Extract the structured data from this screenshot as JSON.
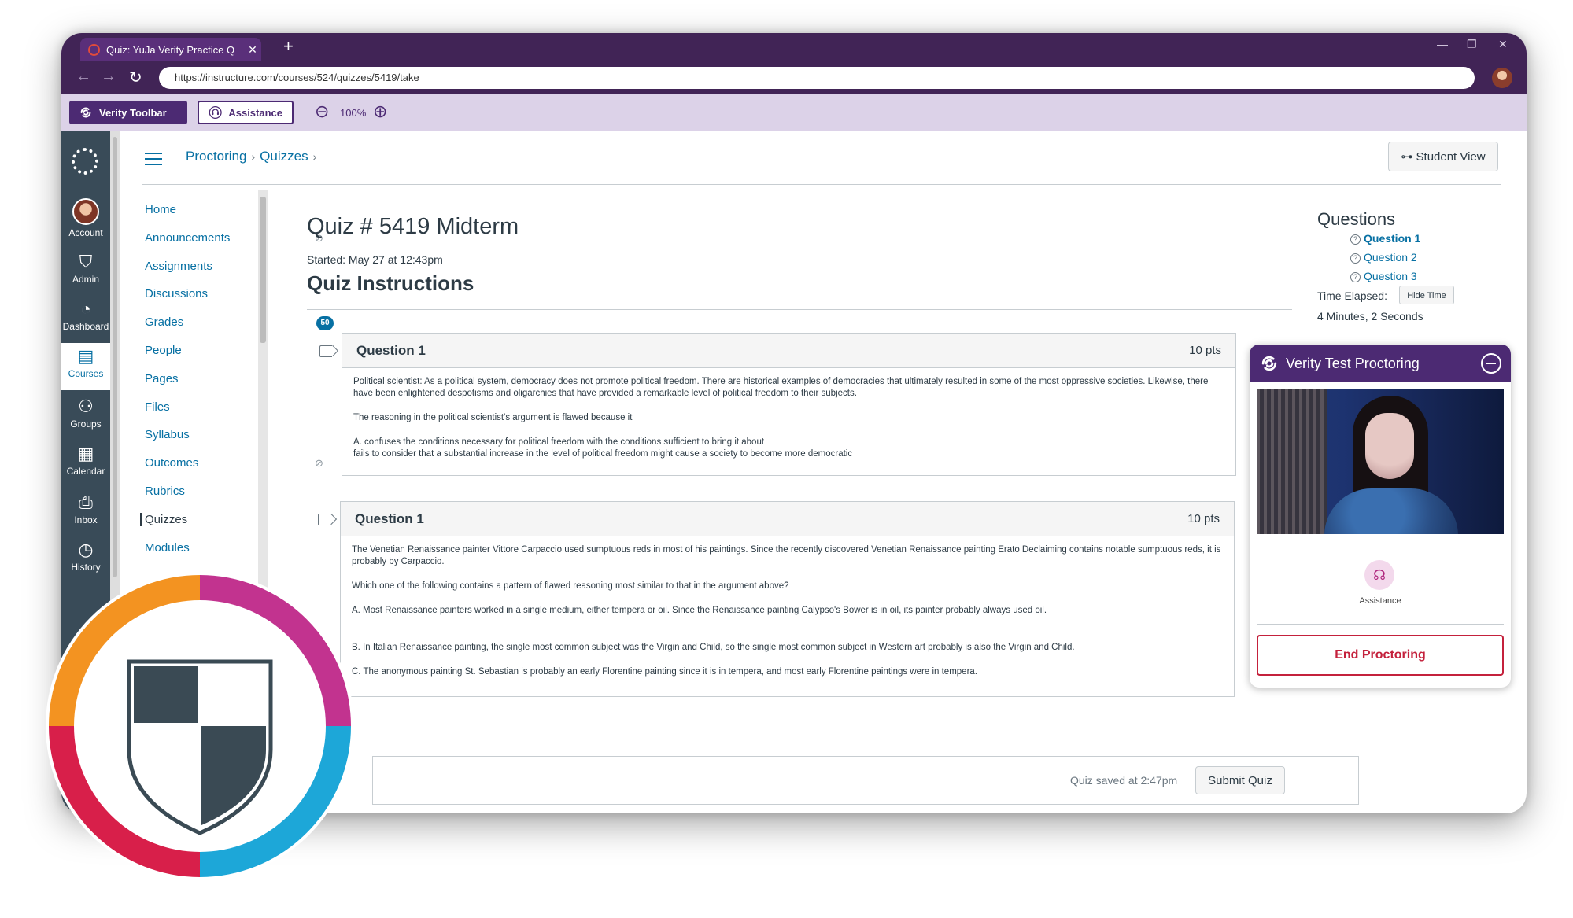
{
  "browser": {
    "tab_title": "Quiz: YuJa Verity Practice Q",
    "new_tab": "+",
    "url": "https://instructure.com/courses/524/quizzes/5419/take"
  },
  "verity_toolbar": {
    "toolbar_label": "Verity Toolbar",
    "assistance_label": "Assistance",
    "zoom_level": "100%"
  },
  "global_nav": {
    "items": [
      {
        "label": "Account",
        "icon": "account-avatar"
      },
      {
        "label": "Admin",
        "icon": "shield-icon"
      },
      {
        "label": "Dashboard",
        "icon": "dashboard-icon"
      },
      {
        "label": "Courses",
        "icon": "book-icon",
        "active": true
      },
      {
        "label": "Groups",
        "icon": "groups-icon"
      },
      {
        "label": "Calendar",
        "icon": "calendar-icon"
      },
      {
        "label": "Inbox",
        "icon": "inbox-icon"
      },
      {
        "label": "History",
        "icon": "clock-icon"
      }
    ]
  },
  "breadcrumb": {
    "items": [
      "Proctoring",
      "Quizzes"
    ]
  },
  "student_view_label": "Student View",
  "course_nav": {
    "items": [
      {
        "label": "Home"
      },
      {
        "label": "Announcements",
        "hidden_icon": true
      },
      {
        "label": "Assignments"
      },
      {
        "label": "Discussions"
      },
      {
        "label": "Grades",
        "badge": "50"
      },
      {
        "label": "People"
      },
      {
        "label": "Pages"
      },
      {
        "label": "Files"
      },
      {
        "label": "Syllabus"
      },
      {
        "label": "Outcomes",
        "hidden_icon": true
      },
      {
        "label": "Rubrics"
      },
      {
        "label": "Quizzes",
        "active": true
      },
      {
        "label": "Modules"
      }
    ]
  },
  "quiz": {
    "title": "Quiz # 5419 Midterm",
    "started": "Started: May 27 at 12:43pm",
    "instructions_heading": "Quiz Instructions",
    "questions": [
      {
        "name": "Question 1",
        "points": "10 pts",
        "paragraphs": [
          "Political scientist: As a political system, democracy does not promote political freedom. There are historical examples of democracies that ultimately resulted in some of the most oppressive societies. Likewise, there have been enlightened despotisms and oligarchies that have provided a remarkable level of political freedom to their subjects.",
          "The reasoning in the political scientist's argument is flawed because it",
          "A. confuses the conditions necessary for political freedom with the conditions sufficient to bring it about",
          "fails to consider that a substantial increase in the level of political freedom might cause a society to become more democratic"
        ]
      },
      {
        "name": "Question 1",
        "points": "10 pts",
        "paragraphs": [
          "The Venetian Renaissance painter Vittore Carpaccio used sumptuous reds in most of his paintings. Since the recently discovered Venetian Renaissance painting Erato Declaiming contains notable sumptuous reds, it is probably by Carpaccio.",
          "Which one of the following contains a pattern of flawed reasoning most similar to that in the argument above?",
          "A. Most Renaissance painters worked in a single medium, either tempera or oil. Since the Renaissance painting Calypso's Bower is in oil, its painter probably always used oil.",
          "B. In Italian Renaissance painting, the single most common subject was the Virgin and Child, so the single most common subject in Western art probably is also the Virgin and Child.",
          "C. The anonymous painting St. Sebastian is probably an early Florentine painting since it is in tempera, and most early Florentine paintings were in tempera."
        ]
      }
    ],
    "saved_text": "Quiz saved at 2:47pm",
    "submit_label": "Submit Quiz"
  },
  "sidebar": {
    "questions_heading": "Questions",
    "question_links": [
      "Question 1",
      "Question 2",
      "Question 3"
    ],
    "time_elapsed_label": "Time Elapsed:",
    "hide_time_label": "Hide Time",
    "time_value": "4 Minutes, 2 Seconds"
  },
  "proctoring": {
    "title": "Verity Test Proctoring",
    "assistance_label": "Assistance",
    "end_label": "End Proctoring"
  },
  "colors": {
    "chrome_purple": "#412456",
    "toolbar_lavender": "#dcd2e8",
    "verity_purple": "#4c2a73",
    "canvas_nav": "#394b58",
    "link_blue": "#0770a3",
    "end_red": "#c4213c"
  }
}
